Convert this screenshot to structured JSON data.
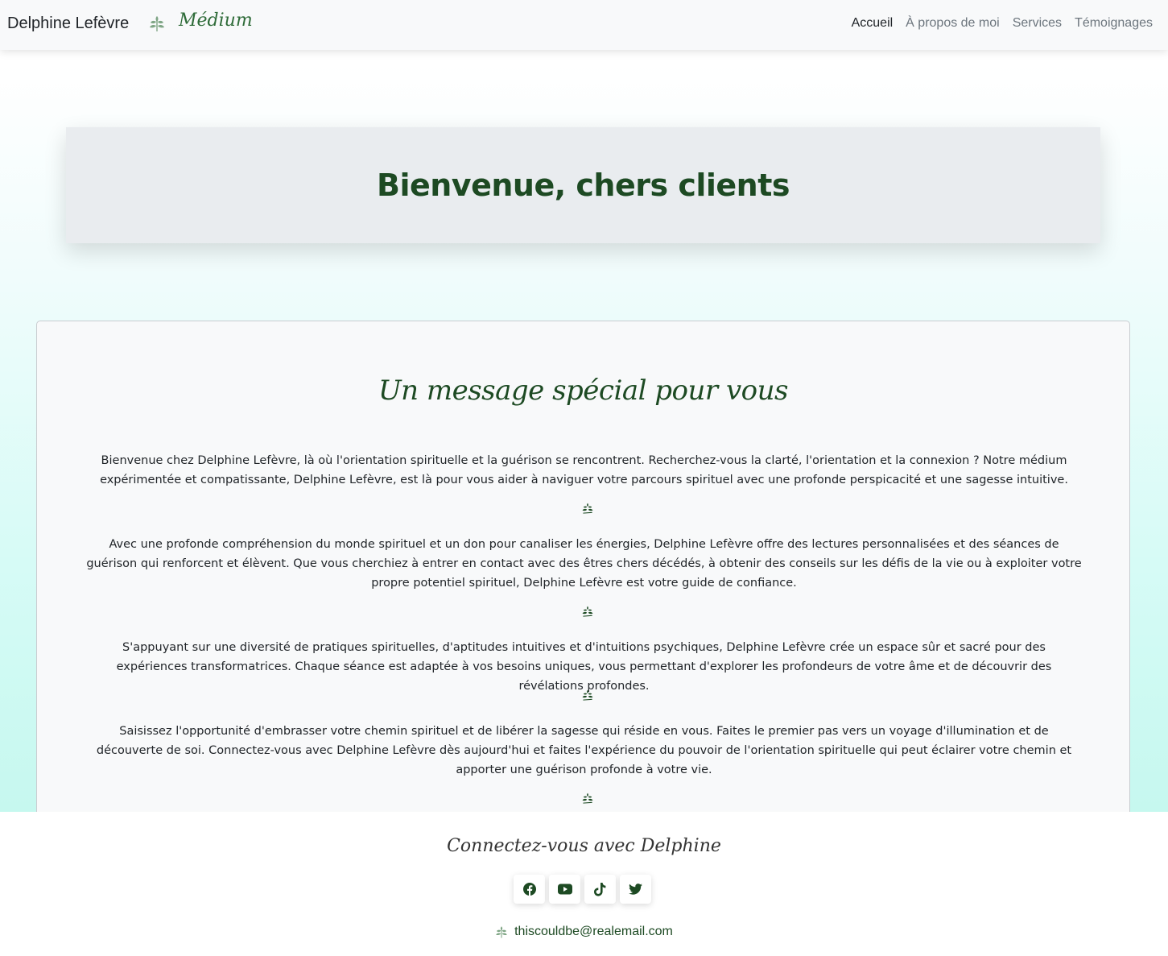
{
  "navbar": {
    "brand": "Delphine Lefèvre",
    "brand_subtitle": "Médium",
    "brand_icon": "leaf-icon",
    "links": [
      {
        "label": "Accueil",
        "active": true
      },
      {
        "label": "À propos de moi",
        "active": false
      },
      {
        "label": "Services",
        "active": false
      },
      {
        "label": "Témoignages",
        "active": false
      }
    ]
  },
  "hero": {
    "title": "Bienvenue, chers clients"
  },
  "message": {
    "title": "Un message spécial pour vous",
    "separator_icon": "leaf-icon",
    "paragraphs": [
      "Bienvenue chez Delphine Lefèvre, là où l'orientation spirituelle et la guérison se rencontrent. Recherchez-vous la clarté, l'orientation et la connexion ? Notre médium expérimentée et compatissante, Delphine Lefèvre, est là pour vous aider à naviguer votre parcours spirituel avec une profonde perspicacité et une sagesse intuitive.",
      "Avec une profonde compréhension du monde spirituel et un don pour canaliser les énergies, Delphine Lefèvre offre des lectures personnalisées et des séances de guérison qui renforcent et élèvent. Que vous cherchiez à entrer en contact avec des êtres chers décédés, à obtenir des conseils sur les défis de la vie ou à exploiter votre propre potentiel spirituel, Delphine Lefèvre est votre guide de confiance.",
      "S'appuyant sur une diversité de pratiques spirituelles, d'aptitudes intuitives et d'intuitions psychiques, Delphine Lefèvre crée un espace sûr et sacré pour des expériences transformatrices. Chaque séance est adaptée à vos besoins uniques, vous permettant d'explorer les profondeurs de votre âme et de découvrir des révélations profondes.",
      "Saisissez l'opportunité d'embrasser votre chemin spirituel et de libérer la sagesse qui réside en vous. Faites le premier pas vers un voyage d'illumination et de découverte de soi. Connectez-vous avec Delphine Lefèvre dès aujourd'hui et faites l'expérience du pouvoir de l'orientation spirituelle qui peut éclairer votre chemin et apporter une guérison profonde à votre vie."
    ]
  },
  "footer": {
    "title": "Connectez-vous avec Delphine",
    "socials": [
      "facebook-icon",
      "youtube-icon",
      "tiktok-icon",
      "twitter-icon"
    ],
    "email": "thiscouldbe@realemail.com"
  },
  "colors": {
    "accent": "#1d4a23",
    "leaf_light": "#7fa585",
    "hero_bg": "#e9ecef",
    "card_bg": "#f8f9fa"
  }
}
